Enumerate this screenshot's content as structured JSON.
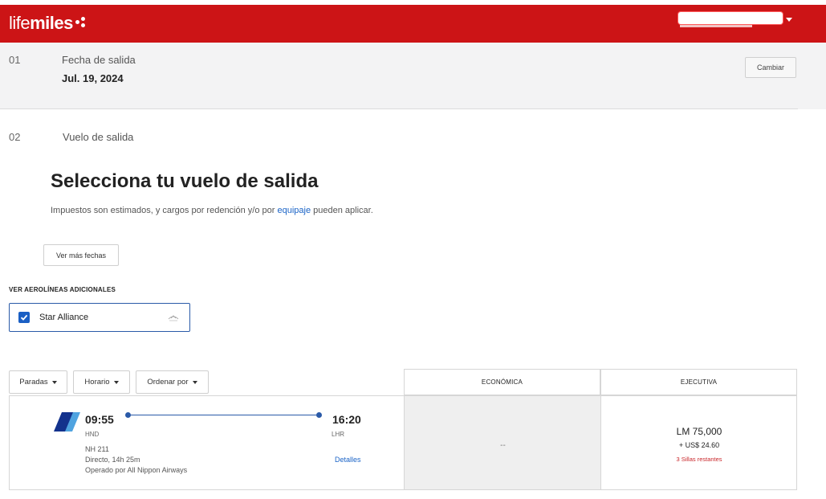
{
  "header": {
    "brand_light": "life",
    "brand_bold": "miles",
    "brand_color": "#cc1416",
    "user_menu_icon": "chevron-down-icon"
  },
  "step1": {
    "number": "01",
    "label": "Fecha de salida",
    "value": "Jul. 19, 2024",
    "change_button": "Cambiar"
  },
  "step2": {
    "number": "02",
    "label": "Vuelo de salida",
    "title": "Selecciona tu vuelo de salida",
    "subtitle_before": "Impuestos son estimados, y cargos por redención y/o por ",
    "subtitle_link": "equipaje",
    "subtitle_after": " pueden aplicar.",
    "more_dates_button": "Ver más fechas"
  },
  "airlines": {
    "label": "VER AEROLÍNEAS ADICIONALES",
    "option": "Star Alliance",
    "checked": true
  },
  "filters": {
    "stops": "Paradas",
    "schedule": "Horario",
    "sort": "Ordenar por"
  },
  "columns": {
    "economy": "ECONÓMICA",
    "business": "EJECUTIVA"
  },
  "flight": {
    "departure_time": "09:55",
    "arrival_time": "16:20",
    "origin": "HND",
    "destination": "LHR",
    "flight_number": "NH 211",
    "duration": "Directo, 14h 25m",
    "operator": "Operado por All Nippon Airways",
    "details_link": "Detalles",
    "economy_price": "--",
    "business_miles": "LM 75,000",
    "business_cash": "+ US$ 24.60",
    "seats_left": "3 Sillas restantes"
  }
}
